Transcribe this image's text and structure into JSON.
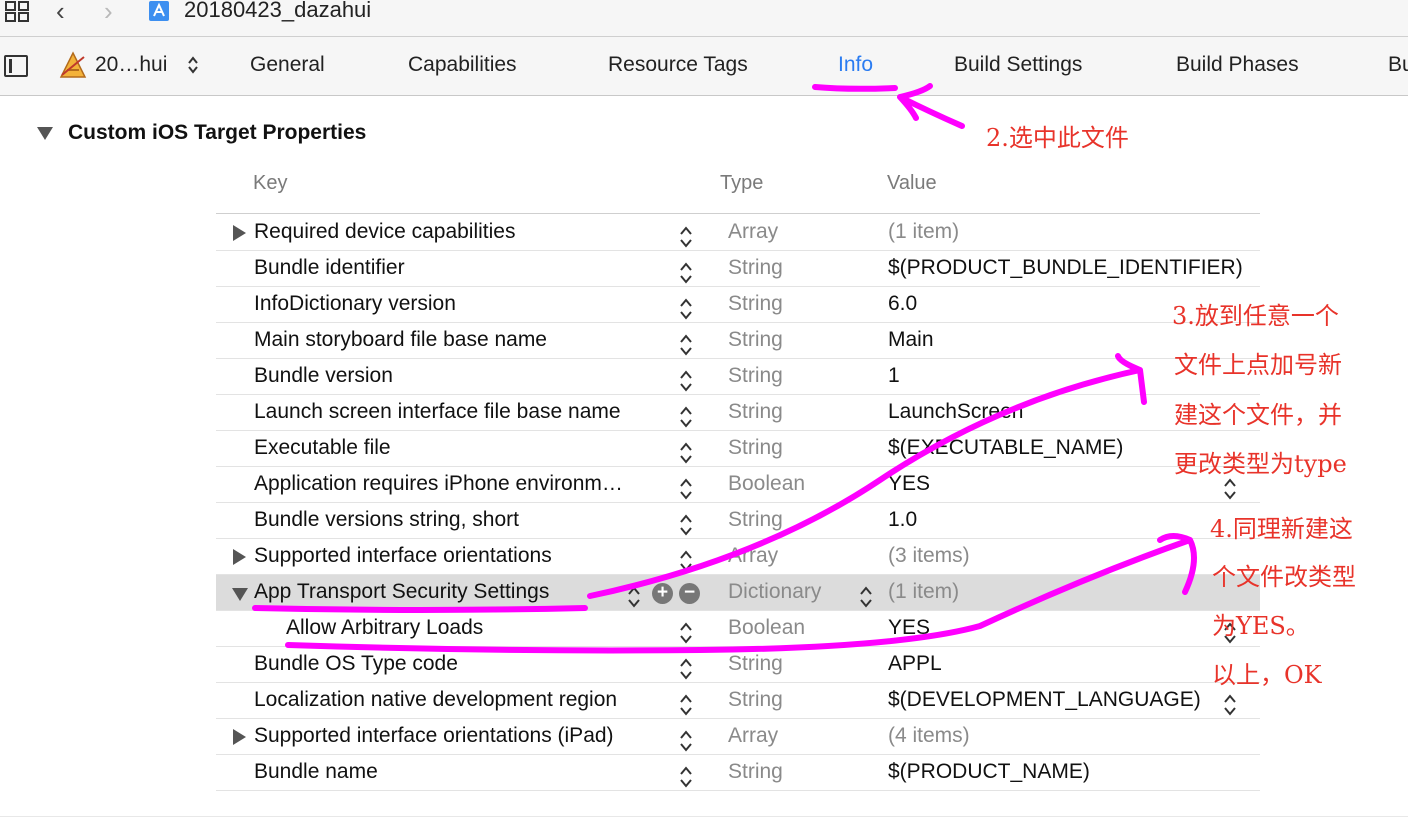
{
  "window": {
    "project_title": "20180423_dazahui",
    "nav_back_glyph": "‹",
    "nav_forward_glyph": "›"
  },
  "tabbar": {
    "target_name": "20…hui",
    "tabs": [
      {
        "label": "General"
      },
      {
        "label": "Capabilities"
      },
      {
        "label": "Resource Tags"
      },
      {
        "label": "Info",
        "active": true
      },
      {
        "label": "Build Settings"
      },
      {
        "label": "Build Phases"
      },
      {
        "label": "Bu"
      }
    ]
  },
  "section": {
    "title": "Custom iOS Target Properties",
    "columns": {
      "key": "Key",
      "type": "Type",
      "value": "Value"
    }
  },
  "rows": [
    {
      "key": "Required device capabilities",
      "type": "Array",
      "value": "(1 item)",
      "expandable": true
    },
    {
      "key": "Bundle identifier",
      "type": "String",
      "value": "$(PRODUCT_BUNDLE_IDENTIFIER)"
    },
    {
      "key": "InfoDictionary version",
      "type": "String",
      "value": "6.0"
    },
    {
      "key": "Main storyboard file base name",
      "type": "String",
      "value": "Main"
    },
    {
      "key": "Bundle version",
      "type": "String",
      "value": "1"
    },
    {
      "key": "Launch screen interface file base name",
      "type": "String",
      "value": "LaunchScreen"
    },
    {
      "key": "Executable file",
      "type": "String",
      "value": "$(EXECUTABLE_NAME)"
    },
    {
      "key": "Application requires iPhone environm…",
      "type": "Boolean",
      "value": "YES"
    },
    {
      "key": "Bundle versions string, short",
      "type": "String",
      "value": "1.0"
    },
    {
      "key": "Supported interface orientations",
      "type": "Array",
      "value": "(3 items)",
      "expandable": true
    },
    {
      "key": "App Transport Security Settings",
      "type": "Dictionary",
      "value": "(1 item)",
      "expanded": true,
      "selected": true
    },
    {
      "key": "Allow Arbitrary Loads",
      "type": "Boolean",
      "value": "YES",
      "child": true
    },
    {
      "key": "Bundle OS Type code",
      "type": "String",
      "value": "APPL"
    },
    {
      "key": "Localization native development region",
      "type": "String",
      "value": "$(DEVELOPMENT_LANGUAGE)"
    },
    {
      "key": "Supported interface orientations (iPad)",
      "type": "Array",
      "value": "(4 items)",
      "expandable": true
    },
    {
      "key": "Bundle name",
      "type": "String",
      "value": "$(PRODUCT_NAME)"
    }
  ],
  "annotations": {
    "step2": "2.选中此文件",
    "step3": [
      "3.放到任意一个",
      "文件上点加号新",
      "建这个文件，并",
      "更改类型为type"
    ],
    "step4": [
      "4.同理新建这",
      "个文件改类型",
      "为YES。",
      "以上，OK"
    ]
  },
  "colors": {
    "accent_tab": "#2b7cf1",
    "annotation_text": "#e8332a",
    "annotation_stroke": "#ff00ff",
    "selected_row": "#dcdcdc"
  },
  "icons": [
    "grid-icon",
    "chevron-left-icon",
    "chevron-right-icon",
    "project-file-icon",
    "sidebar-toggle-icon",
    "target-app-icon",
    "updown-stepper-icon",
    "plus-circle-icon",
    "minus-circle-icon",
    "disclosure-triangle-icon"
  ]
}
